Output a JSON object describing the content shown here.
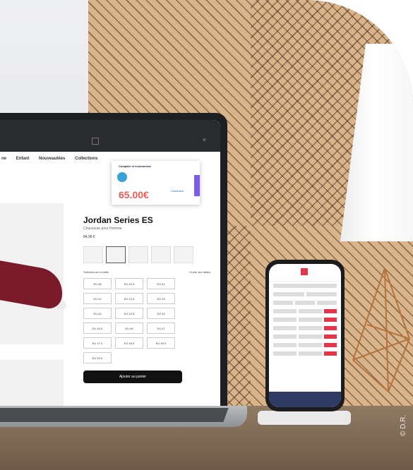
{
  "laptop": {
    "nav": [
      "ne",
      "Enfant",
      "Nouveautées",
      "Collections"
    ],
    "product_title": "Jordan Series ES",
    "product_subtitle": "Chaussure pour Homme",
    "price": "84,99 €",
    "sizes_label": "Sélectionner la taille",
    "sizes_guide": "Guide des tailles",
    "sizes": [
      "EU 38",
      "EU 40.5",
      "EU 41",
      "EU 42",
      "EU 42.5",
      "EU 43",
      "EU 44",
      "EU 44.5",
      "EU 45",
      "EU 45.5",
      "EU 46",
      "EU 47",
      "EU 47.5",
      "EU 48.5",
      "EU 49.5",
      "EU 50.5"
    ],
    "add_button": "Ajouter au panier"
  },
  "popup": {
    "title": "Compare et économisez",
    "price": "65.00€",
    "cashback": "Cashback"
  },
  "credit": "© D.R."
}
